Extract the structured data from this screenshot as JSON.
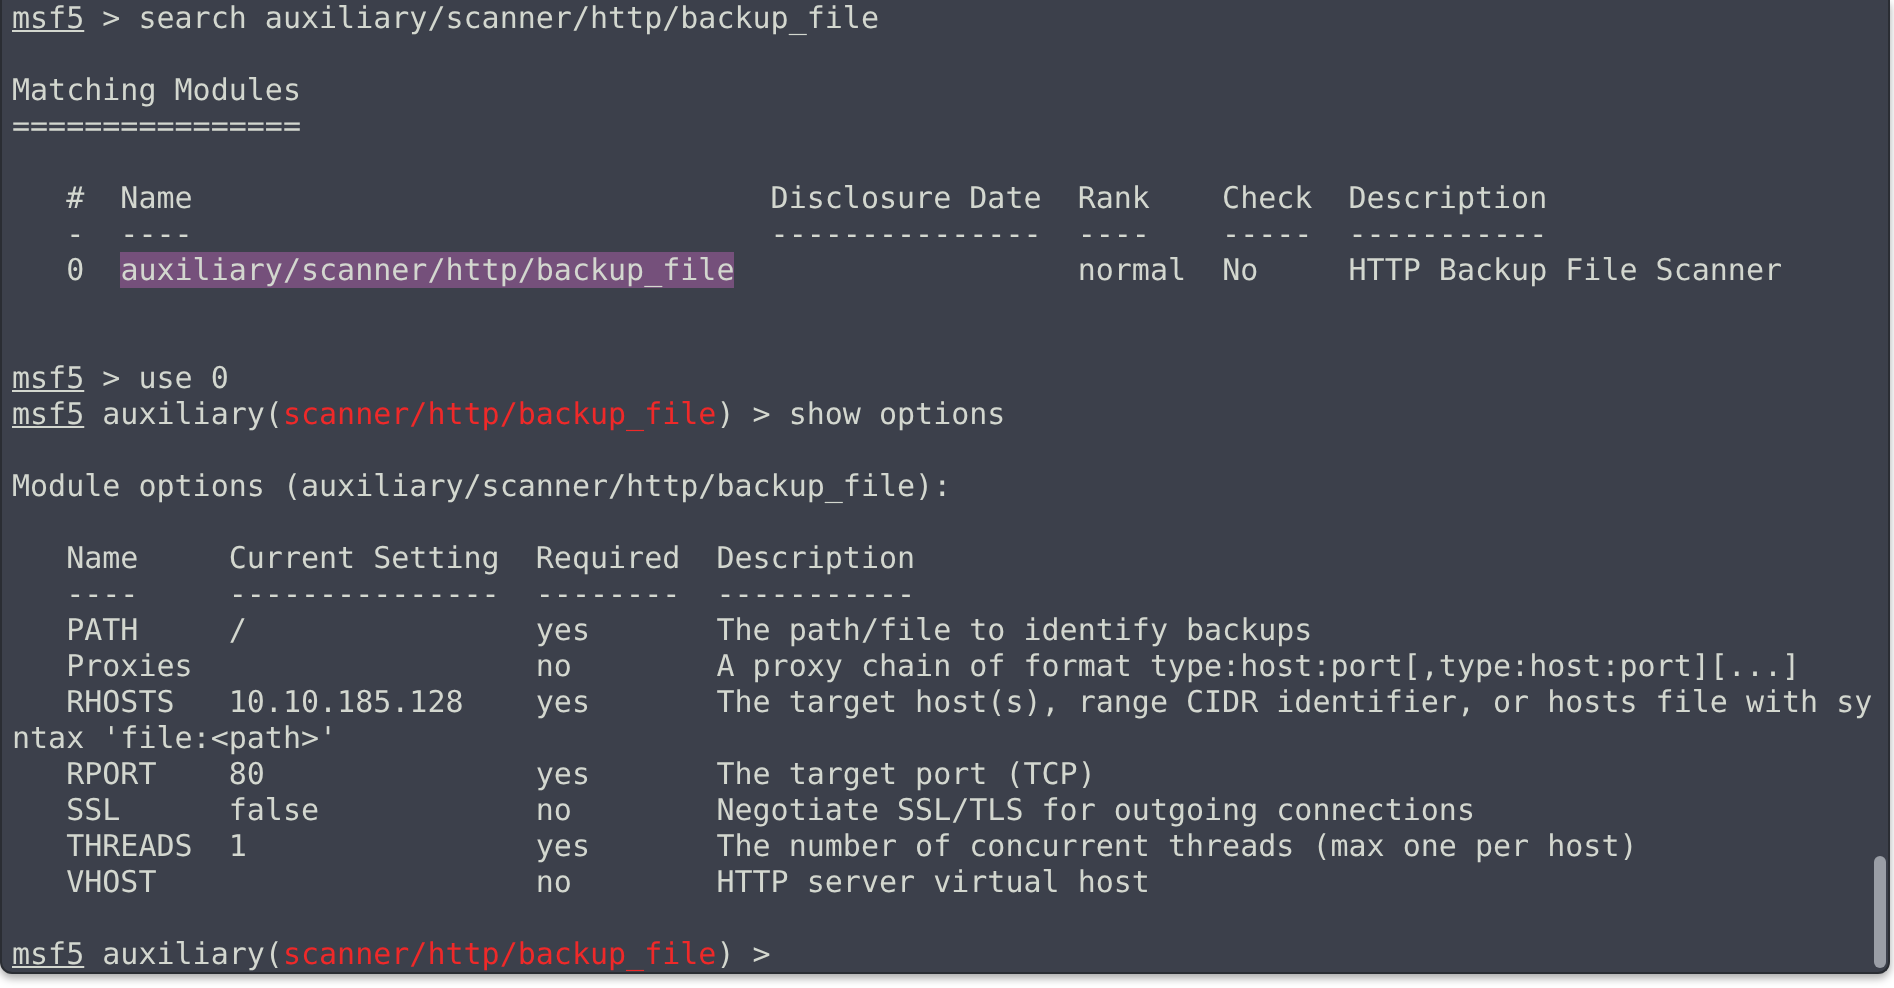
{
  "terminal": {
    "lines": [
      {
        "kind": "text",
        "segments": [
          {
            "kind": "prompt",
            "text": "msf5"
          },
          {
            "kind": "plain",
            "text": " > search auxiliary/scanner/http/backup_file"
          }
        ]
      },
      {
        "kind": "blank"
      },
      {
        "kind": "text",
        "segments": [
          {
            "kind": "plain",
            "text": "Matching Modules"
          }
        ]
      },
      {
        "kind": "text",
        "segments": [
          {
            "kind": "plain",
            "text": "================"
          }
        ]
      },
      {
        "kind": "blank"
      },
      {
        "kind": "text",
        "segments": [
          {
            "kind": "plain",
            "text": "   #  Name                                Disclosure Date  Rank    Check  Description"
          }
        ]
      },
      {
        "kind": "text",
        "segments": [
          {
            "kind": "plain",
            "text": "   -  ----                                ---------------  ----    -----  -----------"
          }
        ]
      },
      {
        "kind": "text",
        "segments": [
          {
            "kind": "plain",
            "text": "   0  "
          },
          {
            "kind": "selection",
            "text": "auxiliary/scanner/http/backup_file"
          },
          {
            "kind": "plain",
            "text": "                   normal  No     HTTP Backup File Scanner"
          }
        ]
      },
      {
        "kind": "blank"
      },
      {
        "kind": "blank"
      },
      {
        "kind": "text",
        "segments": [
          {
            "kind": "prompt",
            "text": "msf5"
          },
          {
            "kind": "plain",
            "text": " > use 0"
          }
        ]
      },
      {
        "kind": "text",
        "segments": [
          {
            "kind": "prompt",
            "text": "msf5"
          },
          {
            "kind": "plain",
            "text": " auxiliary("
          },
          {
            "kind": "module",
            "text": "scanner/http/backup_file"
          },
          {
            "kind": "plain",
            "text": ") > show options"
          }
        ]
      },
      {
        "kind": "blank"
      },
      {
        "kind": "text",
        "segments": [
          {
            "kind": "plain",
            "text": "Module options (auxiliary/scanner/http/backup_file):"
          }
        ]
      },
      {
        "kind": "blank"
      },
      {
        "kind": "text",
        "segments": [
          {
            "kind": "plain",
            "text": "   Name     Current Setting  Required  Description"
          }
        ]
      },
      {
        "kind": "text",
        "segments": [
          {
            "kind": "plain",
            "text": "   ----     ---------------  --------  -----------"
          }
        ]
      },
      {
        "kind": "text",
        "segments": [
          {
            "kind": "plain",
            "text": "   PATH     /                yes       The path/file to identify backups"
          }
        ]
      },
      {
        "kind": "text",
        "segments": [
          {
            "kind": "plain",
            "text": "   Proxies                   no        A proxy chain of format type:host:port[,type:host:port][...]"
          }
        ]
      },
      {
        "kind": "text",
        "segments": [
          {
            "kind": "plain",
            "text": "   RHOSTS   10.10.185.128    yes       The target host(s), range CIDR identifier, or hosts file with sy"
          }
        ]
      },
      {
        "kind": "text",
        "segments": [
          {
            "kind": "plain",
            "text": "ntax 'file:<path>'"
          }
        ]
      },
      {
        "kind": "text",
        "segments": [
          {
            "kind": "plain",
            "text": "   RPORT    80               yes       The target port (TCP)"
          }
        ]
      },
      {
        "kind": "text",
        "segments": [
          {
            "kind": "plain",
            "text": "   SSL      false            no        Negotiate SSL/TLS for outgoing connections"
          }
        ]
      },
      {
        "kind": "text",
        "segments": [
          {
            "kind": "plain",
            "text": "   THREADS  1                yes       The number of concurrent threads (max one per host)"
          }
        ]
      },
      {
        "kind": "text",
        "segments": [
          {
            "kind": "plain",
            "text": "   VHOST                     no        HTTP server virtual host"
          }
        ]
      },
      {
        "kind": "blank"
      },
      {
        "kind": "text",
        "segments": [
          {
            "kind": "prompt",
            "text": "msf5"
          },
          {
            "kind": "plain",
            "text": " auxiliary("
          },
          {
            "kind": "module",
            "text": "scanner/http/backup_file"
          },
          {
            "kind": "plain",
            "text": ") > "
          }
        ]
      }
    ]
  }
}
